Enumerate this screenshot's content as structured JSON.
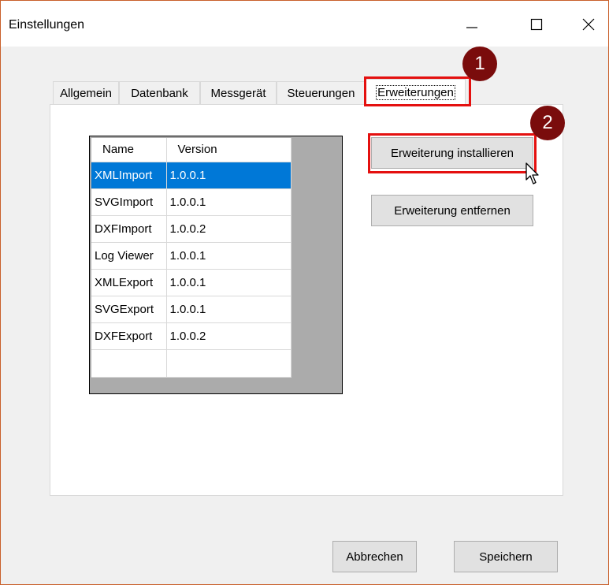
{
  "window": {
    "title": "Einstellungen"
  },
  "tabs": [
    {
      "label": "Allgemein",
      "active": false
    },
    {
      "label": "Datenbank",
      "active": false
    },
    {
      "label": "Messgerät",
      "active": false
    },
    {
      "label": "Steuerungen",
      "active": false
    },
    {
      "label": "Erweiterungen",
      "active": true
    }
  ],
  "extensions_grid": {
    "columns": [
      "Name",
      "Version"
    ],
    "rows": [
      {
        "name": "XMLImport",
        "version": "1.0.0.1",
        "selected": true
      },
      {
        "name": "SVGImport",
        "version": "1.0.0.1",
        "selected": false
      },
      {
        "name": "DXFImport",
        "version": "1.0.0.2",
        "selected": false
      },
      {
        "name": "Log Viewer",
        "version": "1.0.0.1",
        "selected": false
      },
      {
        "name": "XMLExport",
        "version": "1.0.0.1",
        "selected": false
      },
      {
        "name": "SVGExport",
        "version": "1.0.0.1",
        "selected": false
      },
      {
        "name": "DXFExport",
        "version": "1.0.0.2",
        "selected": false
      }
    ]
  },
  "actions": {
    "install_label": "Erweiterung installieren",
    "remove_label": "Erweiterung entfernen"
  },
  "footer": {
    "cancel_label": "Abbrechen",
    "save_label": "Speichern"
  },
  "annotations": {
    "step1": "1",
    "step2": "2"
  },
  "colors": {
    "highlight": "#e4100f",
    "badge": "#7a0c0c",
    "selection": "#0078d7"
  },
  "icons": {
    "minimize": "minimize-icon",
    "maximize": "maximize-icon",
    "close": "close-icon",
    "cursor": "mouse-pointer-icon"
  }
}
